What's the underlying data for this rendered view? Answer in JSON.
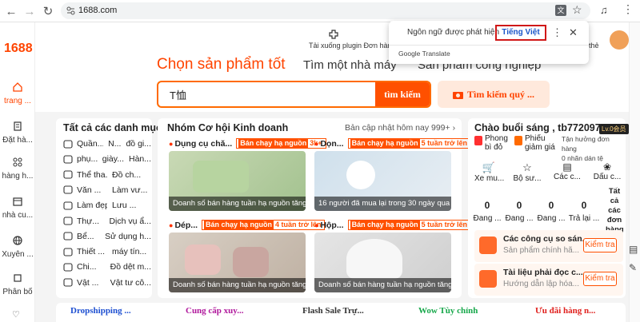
{
  "browser": {
    "url": "1688.com"
  },
  "logo": "1688",
  "rail": [
    {
      "label": "trang ...",
      "icon": "home-icon"
    },
    {
      "label": "Đặt hà...",
      "icon": "order-icon"
    },
    {
      "label": "hàng h...",
      "icon": "grid-icon"
    },
    {
      "label": "nhà cu...",
      "icon": "store-icon"
    },
    {
      "label": "Xuyên ...",
      "icon": "globe-icon"
    },
    {
      "label": "Phân bổ",
      "icon": "distribute-icon"
    }
  ],
  "header": {
    "plugin_text": "Tải xuống plugin Đơn hàng",
    "the_text": "thẻ"
  },
  "translate_popup": {
    "detected": "Ngôn ngữ được phát hiện",
    "target": "Tiếng Việt",
    "brand": "Google Translate"
  },
  "tabs": {
    "active": "Chọn sản phẩm tốt",
    "tab2": "Tìm một nhà máy",
    "tab3": "Sản phẩm công nghiệp"
  },
  "search": {
    "value": "T恤",
    "button": "tìm kiếm",
    "image_button": "Tìm kiếm quý ..."
  },
  "categories": {
    "title": "Tất cả các danh mục",
    "rows": [
      [
        "Quần...",
        "N...",
        "đồ gi..."
      ],
      [
        "phụ...",
        "giày...",
        "Hàn..."
      ],
      [
        "Thể tha...",
        "Đồ ch..."
      ],
      [
        "Văn ...",
        "Làm vư..."
      ],
      [
        "Làm đẹp...",
        "Lưu ..."
      ],
      [
        "Thự...",
        "Dịch vụ ẩ..."
      ],
      [
        "Bể...",
        "Sử dụng h..."
      ],
      [
        "Thiết ...",
        "máy tín..."
      ],
      [
        "Chi...",
        "Đồ dệt m..."
      ],
      [
        "Vật ...",
        "Vật tư cô..."
      ]
    ]
  },
  "opportunity": {
    "title": "Nhóm Cơ hội Kinh doanh",
    "update": "Bản cập nhật hôm nay 999+",
    "items": [
      {
        "name": "Dụng cụ chă...",
        "badge_sold": "Bán chạy hạ nguồn",
        "badge_val": "3k+",
        "caption": "Doanh số bán hàng tuần hạ nguồn tăng vọt"
      },
      {
        "name": "Dọn...",
        "badge_sold": "Bán chạy hạ nguồn",
        "badge_val": "5 tuần trở lên",
        "caption": "16 người đã mua lại trong 30 ngày qua"
      },
      {
        "name": "Dép...",
        "badge_sold": "Bán chạy hạ nguồn",
        "badge_val": "4 tuần trở lên",
        "caption": "Doanh số bán hàng tuần hạ nguồn tăng vọt"
      },
      {
        "name": "Hộp...",
        "badge_sold": "Bán chạy hạ nguồn",
        "badge_val": "5 tuần trở lên",
        "caption": "Doanh số bán hàng tuần hạ nguồn tăng vọt"
      }
    ]
  },
  "right_panel": {
    "greeting": "Chào buổi sáng , tb772097...",
    "level": "Lv.0会员",
    "phong": "Phong bì đỏ",
    "phieu": "Phiếu giảm giá",
    "tan_huong": "Tận hưởng đơn hàng",
    "nhau": "0 nhãn dán tệ",
    "quick": [
      "Xe mu...",
      "Bộ sư...",
      "Các c...",
      "Dấu c..."
    ],
    "stats": [
      {
        "value": "0",
        "label": "Đang ..."
      },
      {
        "value": "0",
        "label": "Đang ..."
      },
      {
        "value": "0",
        "label": "Đang ..."
      },
      {
        "value": "0",
        "label": "Trả lại ..."
      }
    ],
    "all_orders": "Tất cả các đơn hàng",
    "tools": [
      {
        "title": "Các công cụ so sán...",
        "sub": "Sản phẩm chính hã...",
        "button": "Kiểm tra"
      },
      {
        "title": "Tài liệu phải đọc c...",
        "sub": "Hướng dẫn lập hóa...",
        "button": "Kiểm tra"
      }
    ]
  },
  "bottom": [
    "Dropshipping ...",
    "Cung cấp xuy...",
    "Flash Sale Trự...",
    "Wow Tùy chỉnh",
    "Ưu đãi hàng n..."
  ],
  "colors": {
    "brand": "#ff4400",
    "accent": "#ff5000",
    "link": "#1a56c8"
  }
}
